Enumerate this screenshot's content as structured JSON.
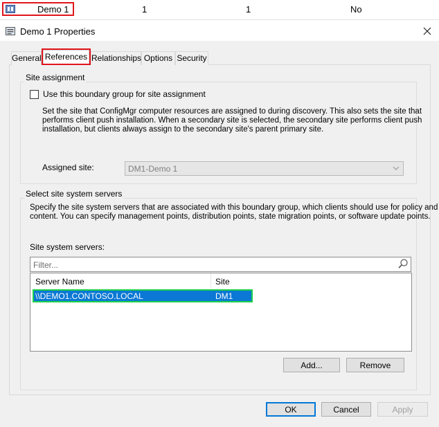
{
  "list_row": {
    "name": "Demo 1",
    "col2": "1",
    "col3": "1",
    "col4": "No"
  },
  "dialog": {
    "title": "Demo 1 Properties",
    "tabs": [
      "General",
      "References",
      "Relationships",
      "Options",
      "Security"
    ],
    "active_tab": "References",
    "site_assignment": {
      "group_title": "Site assignment",
      "checkbox_label": "Use this boundary group for site assignment",
      "checkbox_checked": false,
      "description_lines": [
        "Set the site that ConfigMgr computer resources are assigned to during discovery. This also sets the site that",
        "performs client push installation. When a secondary site is selected, the secondary site performs client push",
        "installation, but clients always assign to the secondary site's parent primary site."
      ],
      "assigned_site_label": "Assigned site:",
      "assigned_site_value": "DM1-Demo 1"
    },
    "site_system_servers": {
      "group_title": "Select site system servers",
      "description_lines": [
        "Specify the site system servers that are associated with this boundary group, which clients should use for policy and",
        "content. You can specify management points, distribution points, state migration points, or software update points."
      ],
      "list_label": "Site system servers:",
      "filter_placeholder": "Filter...",
      "columns": [
        "Server Name",
        "Site"
      ],
      "rows": [
        {
          "server": "\\\\DEMO1.CONTOSO.LOCAL",
          "site": "DM1",
          "selected": true
        }
      ],
      "add_label": "Add...",
      "remove_label": "Remove"
    },
    "buttons": {
      "ok": "OK",
      "cancel": "Cancel",
      "apply": "Apply"
    }
  },
  "colors": {
    "highlight_red": "#e0151b",
    "selection_blue": "#0a78d4",
    "selection_outline_green": "#1ed04a",
    "ok_border": "#0078d7"
  },
  "icons": [
    "boundary-group-icon",
    "properties-icon",
    "close-icon",
    "search-icon",
    "chevron-down-icon"
  ]
}
